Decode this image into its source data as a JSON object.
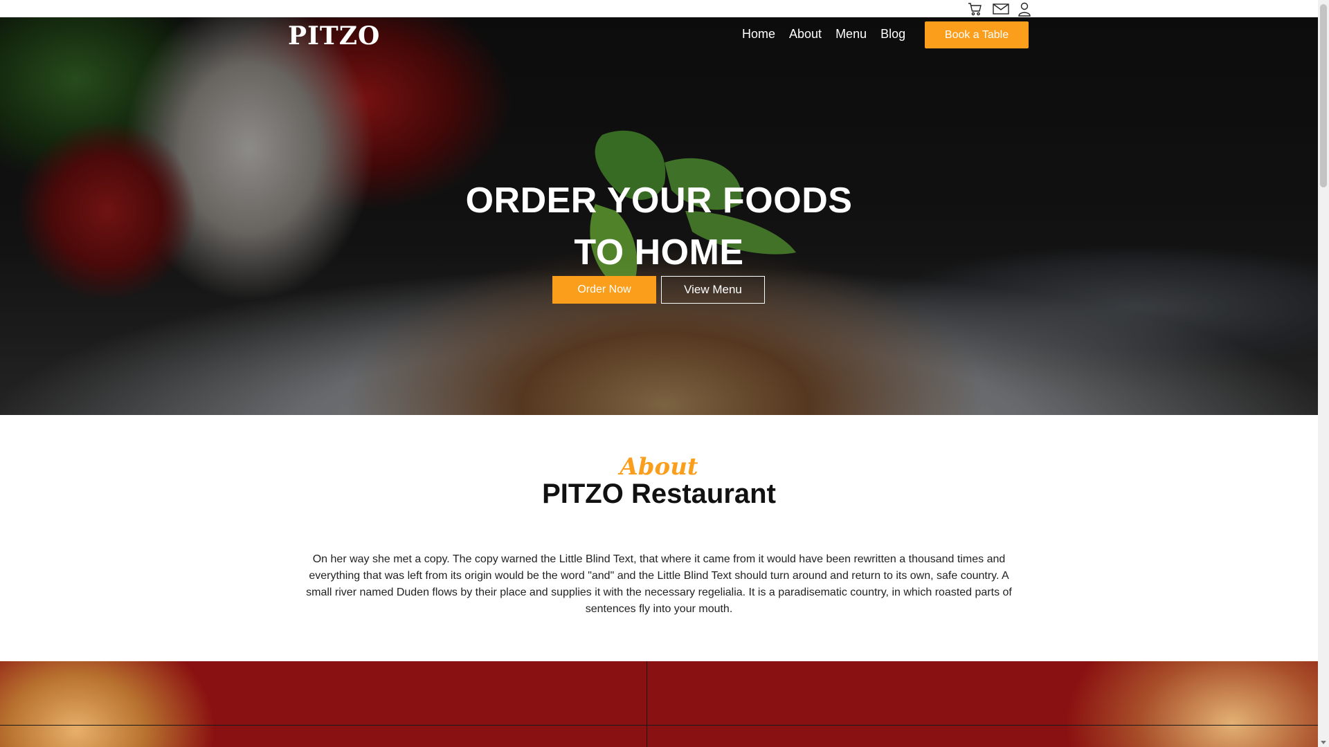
{
  "utility": {
    "icons": [
      "cart-icon",
      "mail-icon",
      "user-icon"
    ]
  },
  "header": {
    "logo": "PITZO",
    "nav": [
      "Home",
      "About",
      "Menu",
      "Blog"
    ],
    "book_label": "Book a Table"
  },
  "hero": {
    "title": "ORDER YOUR FOODS TO HOME",
    "order_label": "Order Now",
    "menu_label": "View Menu"
  },
  "about": {
    "script_label": "About",
    "title": "PITZO Restaurant",
    "text": "On her way she met a copy. The copy warned the Little Blind Text, that where it came from it would have been rewritten a thousand times and everything that was left from its origin would be the word \"and\" and the Little Blind Text should turn around and return to its own, safe country. A small river named Duden flows by their place and supplies it with the necessary regelialia. It is a paradisematic country, in which roasted parts of sentences fly into your mouth."
  },
  "colors": {
    "accent": "#fa9e1b",
    "text_dark": "#111111",
    "hero_overlay": "#000000"
  }
}
